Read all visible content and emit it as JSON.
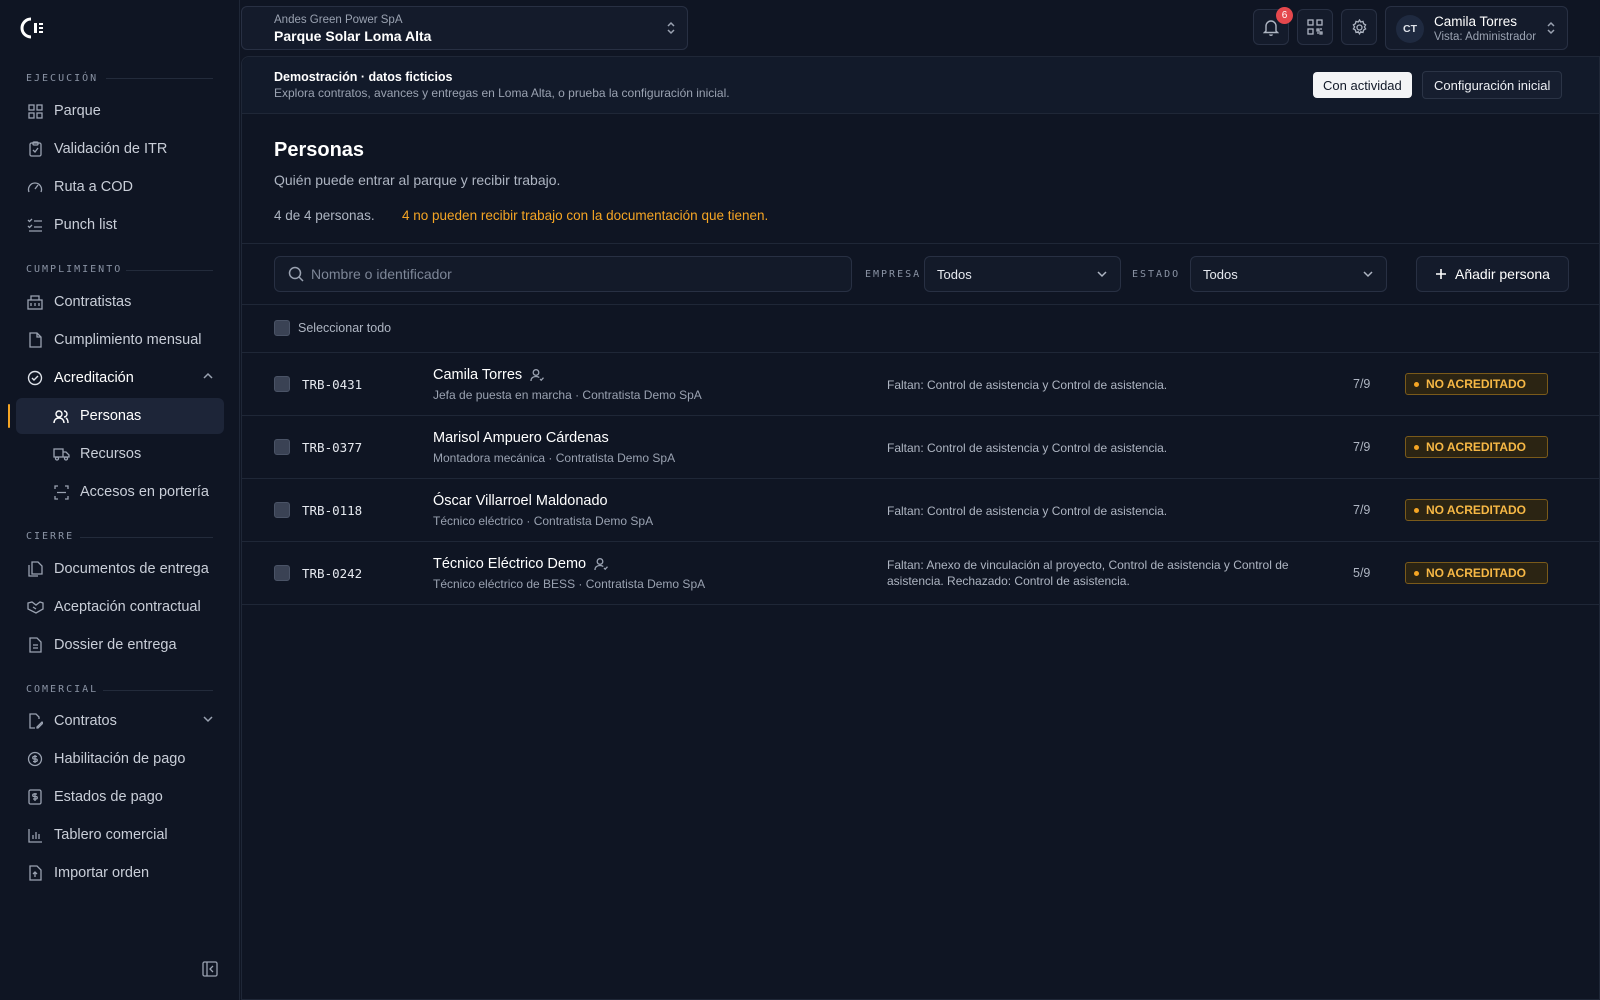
{
  "sidebar": {
    "sections": [
      {
        "label": "EJECUCIÓN"
      },
      {
        "label": "CUMPLIMIENTO"
      },
      {
        "label": "CIERRE"
      },
      {
        "label": "COMERCIAL"
      }
    ],
    "items": [
      {
        "label": "Parque",
        "icon": "grid-icon"
      },
      {
        "label": "Validación de ITR",
        "icon": "clipboard-check-icon"
      },
      {
        "label": "Ruta a COD",
        "icon": "gauge-icon"
      },
      {
        "label": "Punch list",
        "icon": "list-check-icon"
      },
      {
        "label": "Contratistas",
        "icon": "building-icon"
      },
      {
        "label": "Cumplimiento mensual",
        "icon": "file-icon"
      },
      {
        "label": "Acreditación",
        "icon": "badge-check-icon"
      },
      {
        "label": "Personas",
        "icon": "users-icon"
      },
      {
        "label": "Recursos",
        "icon": "truck-icon"
      },
      {
        "label": "Accesos en portería",
        "icon": "scan-icon"
      },
      {
        "label": "Documentos de entrega",
        "icon": "files-icon"
      },
      {
        "label": "Aceptación contractual",
        "icon": "handshake-icon"
      },
      {
        "label": "Dossier de entrega",
        "icon": "document-icon"
      },
      {
        "label": "Contratos",
        "icon": "file-edit-icon"
      },
      {
        "label": "Habilitación de pago",
        "icon": "dollar-circle-icon"
      },
      {
        "label": "Estados de pago",
        "icon": "dollar-file-icon"
      },
      {
        "label": "Tablero comercial",
        "icon": "bar-chart-icon"
      },
      {
        "label": "Importar orden",
        "icon": "file-upload-icon"
      }
    ]
  },
  "header": {
    "org": "Andes Green Power SpA",
    "project": "Parque Solar Loma Alta",
    "notifications_count": "6",
    "user": {
      "initials": "CT",
      "name": "Camila Torres",
      "role": "Vista: Administrador"
    }
  },
  "banner": {
    "title": "Demostración · datos ficticios",
    "subtitle": "Explora contratos, avances y entregas en Loma Alta, o prueba la configuración inicial.",
    "btn_active": "Con actividad",
    "btn_config": "Configuración inicial"
  },
  "page": {
    "title": "Personas",
    "subtitle": "Quién puede entrar al parque y recibir trabajo.",
    "count": "4 de 4 personas.",
    "warning": "4 no pueden recibir trabajo con la documentación que tienen."
  },
  "filters": {
    "search_placeholder": "Nombre o identificador",
    "company_label": "EMPRESA",
    "company_value": "Todos",
    "status_label": "ESTADO",
    "status_value": "Todos",
    "add_label": "Añadir persona",
    "select_all": "Seleccionar todo"
  },
  "people": [
    {
      "id": "TRB-0431",
      "name": "Camila Torres",
      "user_icon": true,
      "role": "Jefa de puesta en marcha · Contratista Demo SpA",
      "missing": "Faltan: Control de asistencia y Control de asistencia.",
      "score": "7/9",
      "status": "NO ACREDITADO"
    },
    {
      "id": "TRB-0377",
      "name": "Marisol Ampuero Cárdenas",
      "user_icon": false,
      "role": "Montadora mecánica · Contratista Demo SpA",
      "missing": "Faltan: Control de asistencia y Control de asistencia.",
      "score": "7/9",
      "status": "NO ACREDITADO"
    },
    {
      "id": "TRB-0118",
      "name": "Óscar Villarroel Maldonado",
      "user_icon": false,
      "role": "Técnico eléctrico · Contratista Demo SpA",
      "missing": "Faltan: Control de asistencia y Control de asistencia.",
      "score": "7/9",
      "status": "NO ACREDITADO"
    },
    {
      "id": "TRB-0242",
      "name": "Técnico Eléctrico Demo",
      "user_icon": true,
      "role": "Técnico eléctrico de BESS · Contratista Demo SpA",
      "missing": "Faltan: Anexo de vinculación al proyecto, Control de asistencia y Control de asistencia. Rechazado: Control de asistencia.",
      "score": "5/9",
      "status": "NO ACREDITADO"
    }
  ],
  "colors": {
    "accent": "#f5a524",
    "badge_bg": "#2b2413",
    "notif": "#e5484d",
    "background": "#0f1523"
  }
}
